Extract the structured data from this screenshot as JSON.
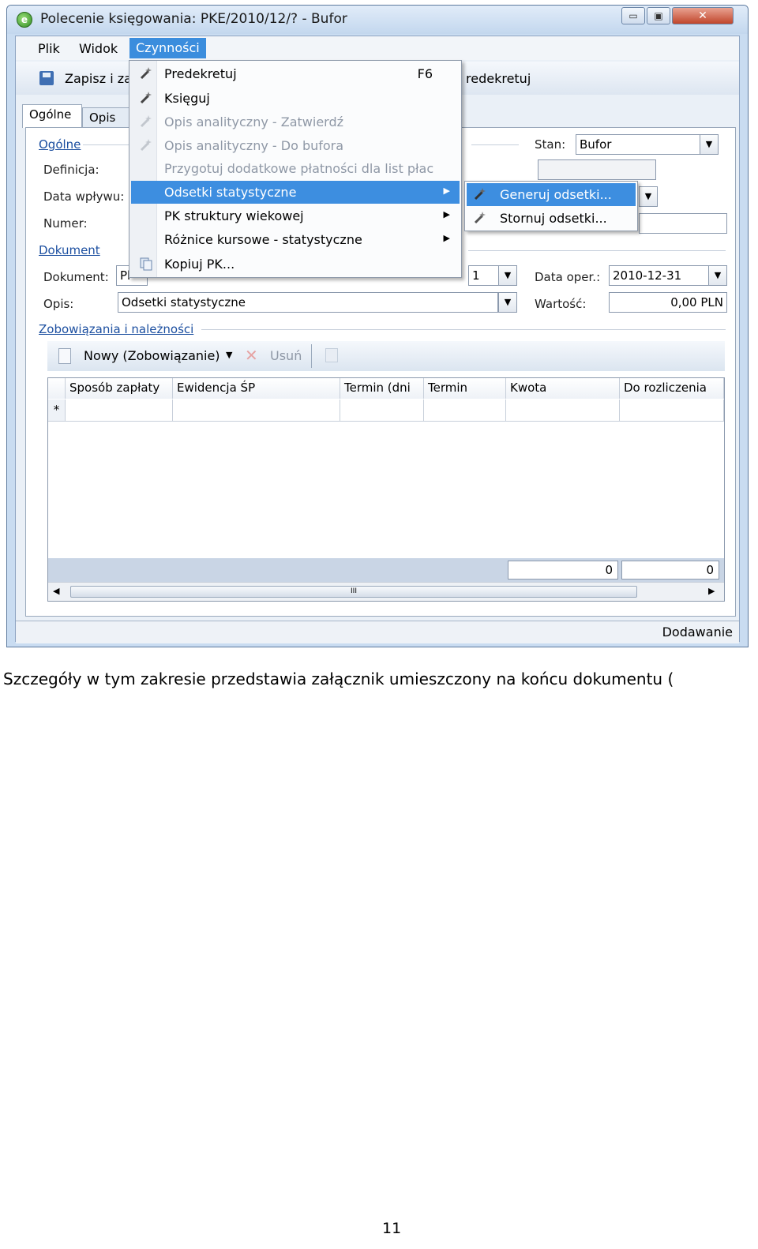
{
  "window": {
    "title": "Polecenie księgowania: PKE/2010/12/? - Bufor",
    "app_icon": "e",
    "minimize_glyph": "▭",
    "maximize_glyph": "▣",
    "close_glyph": "✕"
  },
  "menubar": {
    "items": [
      "Plik",
      "Widok",
      "Czynności"
    ]
  },
  "toolbar": {
    "save_label": "Zapisz i za",
    "predekretuj_label": "redekretuj"
  },
  "tabs": [
    "Ogólne",
    "Opis an"
  ],
  "general": {
    "group_title": "Ogólne",
    "definicja_label": "Definicja:",
    "data_wplywu_label": "Data wpływu:",
    "numer_label": "Numer:",
    "stan_label": "Stan:",
    "stan_value": "Bufor"
  },
  "dokument": {
    "group_title": "Dokument",
    "dokument_label": "Dokument:",
    "dokument_value": "Pl",
    "date_partial": "1",
    "data_oper_label": "Data oper.:",
    "data_oper_value": "2010-12-31",
    "opis_label": "Opis:",
    "opis_value": "Odsetki statystyczne",
    "wartosc_label": "Wartość:",
    "wartosc_value": "0,00 PLN"
  },
  "zobowiazania": {
    "group_title": "Zobowiązania i należności",
    "new_button": "Nowy (Zobowiązanie)",
    "delete_button": "Usuń",
    "columns": [
      "Sposób zapłaty",
      "Ewidencja ŚP",
      "Termin (dni",
      "Termin",
      "Kwota",
      "Do rozliczenia"
    ],
    "new_row_marker": "*",
    "footer_totals": [
      "0",
      "0"
    ],
    "scroll_thumb": "III"
  },
  "status": {
    "mode": "Dodawanie"
  },
  "menu": {
    "items": [
      {
        "label": "Predekretuj",
        "shortcut": "F6"
      },
      {
        "label": "Księguj"
      },
      {
        "label": "Opis analityczny - Zatwierdź"
      },
      {
        "label": "Opis analityczny - Do bufora"
      },
      {
        "label": "Przygotuj dodatkowe płatności dla list płac"
      },
      {
        "label": "Odsetki statystyczne"
      },
      {
        "label": "PK struktury wiekowej"
      },
      {
        "label": "Różnice kursowe - statystyczne"
      },
      {
        "label": "Kopiuj PK..."
      }
    ],
    "submenu": [
      {
        "label": "Generuj odsetki..."
      },
      {
        "label": "Stornuj odsetki..."
      }
    ]
  },
  "document_text": {
    "caption": "Szczegóły w tym zakresie przedstawia załącznik umieszczony na końcu dokumentu (",
    "page_number": "11"
  },
  "colors": {
    "menu_highlight": "#3d8ee0",
    "group_title": "#1c4fa0",
    "window_frame": "#c9dcf1"
  }
}
